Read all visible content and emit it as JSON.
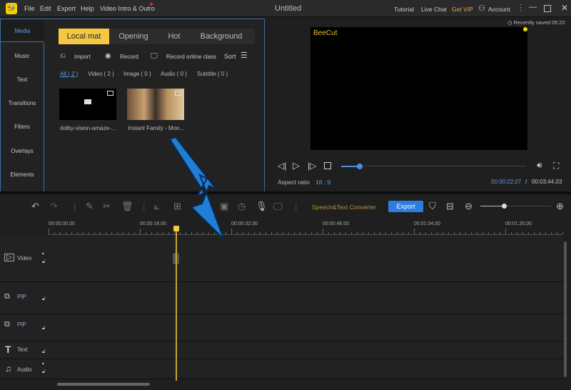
{
  "titlebar": {
    "logo": "Bee",
    "menu": [
      "File",
      "Edit",
      "Export",
      "Help",
      "Video Intro & Outro"
    ],
    "title": "Untitled",
    "tutorial": "Tutorial",
    "live_chat": "Live Chat",
    "get_vip": "Get VIP",
    "account": "Account"
  },
  "sidebar": {
    "items": [
      "Media",
      "Music",
      "Text",
      "Transitions",
      "Filters",
      "Overlays",
      "Elements"
    ]
  },
  "media": {
    "tabs": [
      "Local mat",
      "Opening",
      "Hot",
      "Background"
    ],
    "actions": {
      "import": "Import",
      "record": "Record",
      "record_online": "Record online class",
      "sort": "Sort"
    },
    "filters": [
      "All ( 2 )",
      "Video ( 2 )",
      "Image ( 0 )",
      "Audio ( 0 )",
      "Subtitle ( 0 )"
    ],
    "files": [
      "dolby-vision-amaze-...",
      "Instant Family - Mon..."
    ]
  },
  "preview": {
    "saved": "Recently saved 05:22",
    "watermark": "BeeCut",
    "aspect_label": "Aspect ratio",
    "aspect_value": "16 : 9",
    "current_time": "00:00:22.07",
    "separator": "/",
    "total_time": "00:03:44.03",
    "progress": 0.1
  },
  "toolbar": {
    "speech": "Speech&Text Converter",
    "export": "Export",
    "zoom_level": 0.33
  },
  "timeline": {
    "ruler": [
      "00:00:00.00",
      "00:00:16.00",
      "00:00:32.00",
      "00:00:48.00",
      "00:01:04.00",
      "00:01:20.00"
    ],
    "tracks": [
      "Video",
      "PIP",
      "PIP",
      "Text",
      "Audio"
    ]
  },
  "colors": {
    "accent": "#f5c842",
    "blue": "#2d7de0",
    "panel_border": "#3d6fa5"
  }
}
